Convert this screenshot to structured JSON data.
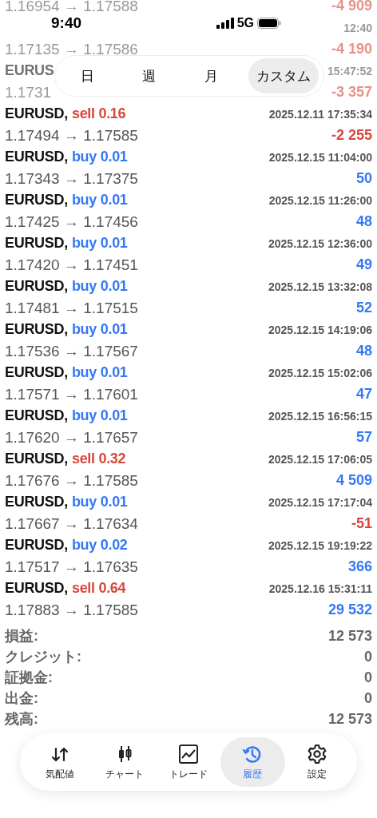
{
  "status_bar": {
    "time": "9:40",
    "network": "5G"
  },
  "faded_rows": [
    {
      "prices": "1.16954 → 1.17588",
      "profit": "-4 909"
    },
    {
      "time": "12:40",
      "prices": "1.17135 → 1.17586",
      "profit": "-4 190"
    },
    {
      "symbol": "EURUS",
      "time": "15:47:52",
      "prices": "1.1731",
      "profit": "-3 357"
    }
  ],
  "period_tabs": [
    {
      "label": "日",
      "selected": false
    },
    {
      "label": "週",
      "selected": false
    },
    {
      "label": "月",
      "selected": false
    },
    {
      "label": "カスタム",
      "selected": true
    }
  ],
  "trades": [
    {
      "symbol": "EURUSD,",
      "order": "sell 0.16",
      "kind": "sell",
      "time": "2025.12.11 17:35:34",
      "prices": "1.17494 → 1.17585",
      "profit": "-2 255",
      "color": "#d9473a"
    },
    {
      "symbol": "EURUSD,",
      "order": "buy 0.01",
      "kind": "buy",
      "time": "2025.12.15 11:04:00",
      "prices": "1.17343 → 1.17375",
      "profit": "50",
      "color": "#3478f6"
    },
    {
      "symbol": "EURUSD,",
      "order": "buy 0.01",
      "kind": "buy",
      "time": "2025.12.15 11:26:00",
      "prices": "1.17425 → 1.17456",
      "profit": "48",
      "color": "#3478f6"
    },
    {
      "symbol": "EURUSD,",
      "order": "buy 0.01",
      "kind": "buy",
      "time": "2025.12.15 12:36:00",
      "prices": "1.17420 → 1.17451",
      "profit": "49",
      "color": "#3478f6"
    },
    {
      "symbol": "EURUSD,",
      "order": "buy 0.01",
      "kind": "buy",
      "time": "2025.12.15 13:32:08",
      "prices": "1.17481 → 1.17515",
      "profit": "52",
      "color": "#3478f6"
    },
    {
      "symbol": "EURUSD,",
      "order": "buy 0.01",
      "kind": "buy",
      "time": "2025.12.15 14:19:06",
      "prices": "1.17536 → 1.17567",
      "profit": "48",
      "color": "#3478f6"
    },
    {
      "symbol": "EURUSD,",
      "order": "buy 0.01",
      "kind": "buy",
      "time": "2025.12.15 15:02:06",
      "prices": "1.17571 → 1.17601",
      "profit": "47",
      "color": "#3478f6"
    },
    {
      "symbol": "EURUSD,",
      "order": "buy 0.01",
      "kind": "buy",
      "time": "2025.12.15 16:56:15",
      "prices": "1.17620 → 1.17657",
      "profit": "57",
      "color": "#3478f6"
    },
    {
      "symbol": "EURUSD,",
      "order": "sell 0.32",
      "kind": "sell",
      "time": "2025.12.15 17:06:05",
      "prices": "1.17676 → 1.17585",
      "profit": "4 509",
      "color": "#3478f6"
    },
    {
      "symbol": "EURUSD,",
      "order": "buy 0.01",
      "kind": "buy",
      "time": "2025.12.15 17:17:04",
      "prices": "1.17667 → 1.17634",
      "profit": "-51",
      "color": "#d9473a"
    },
    {
      "symbol": "EURUSD,",
      "order": "buy 0.02",
      "kind": "buy",
      "time": "2025.12.15 19:19:22",
      "prices": "1.17517 → 1.17635",
      "profit": "366",
      "color": "#3478f6"
    },
    {
      "symbol": "EURUSD,",
      "order": "sell 0.64",
      "kind": "sell",
      "time": "2025.12.16 15:31:11",
      "prices": "1.17883 → 1.17585",
      "profit": "29 532",
      "color": "#3478f6"
    }
  ],
  "summary": [
    {
      "label": "損益:",
      "value": "12 573"
    },
    {
      "label": "クレジット:",
      "value": "0"
    },
    {
      "label": "証拠金:",
      "value": "0"
    },
    {
      "label": "出金:",
      "value": "0"
    },
    {
      "label": "残高:",
      "value": "12 573"
    }
  ],
  "bottom_nav": [
    {
      "label": "気配値",
      "selected": false
    },
    {
      "label": "チャート",
      "selected": false
    },
    {
      "label": "トレード",
      "selected": false
    },
    {
      "label": "履歴",
      "selected": true
    },
    {
      "label": "設定",
      "selected": false
    }
  ]
}
